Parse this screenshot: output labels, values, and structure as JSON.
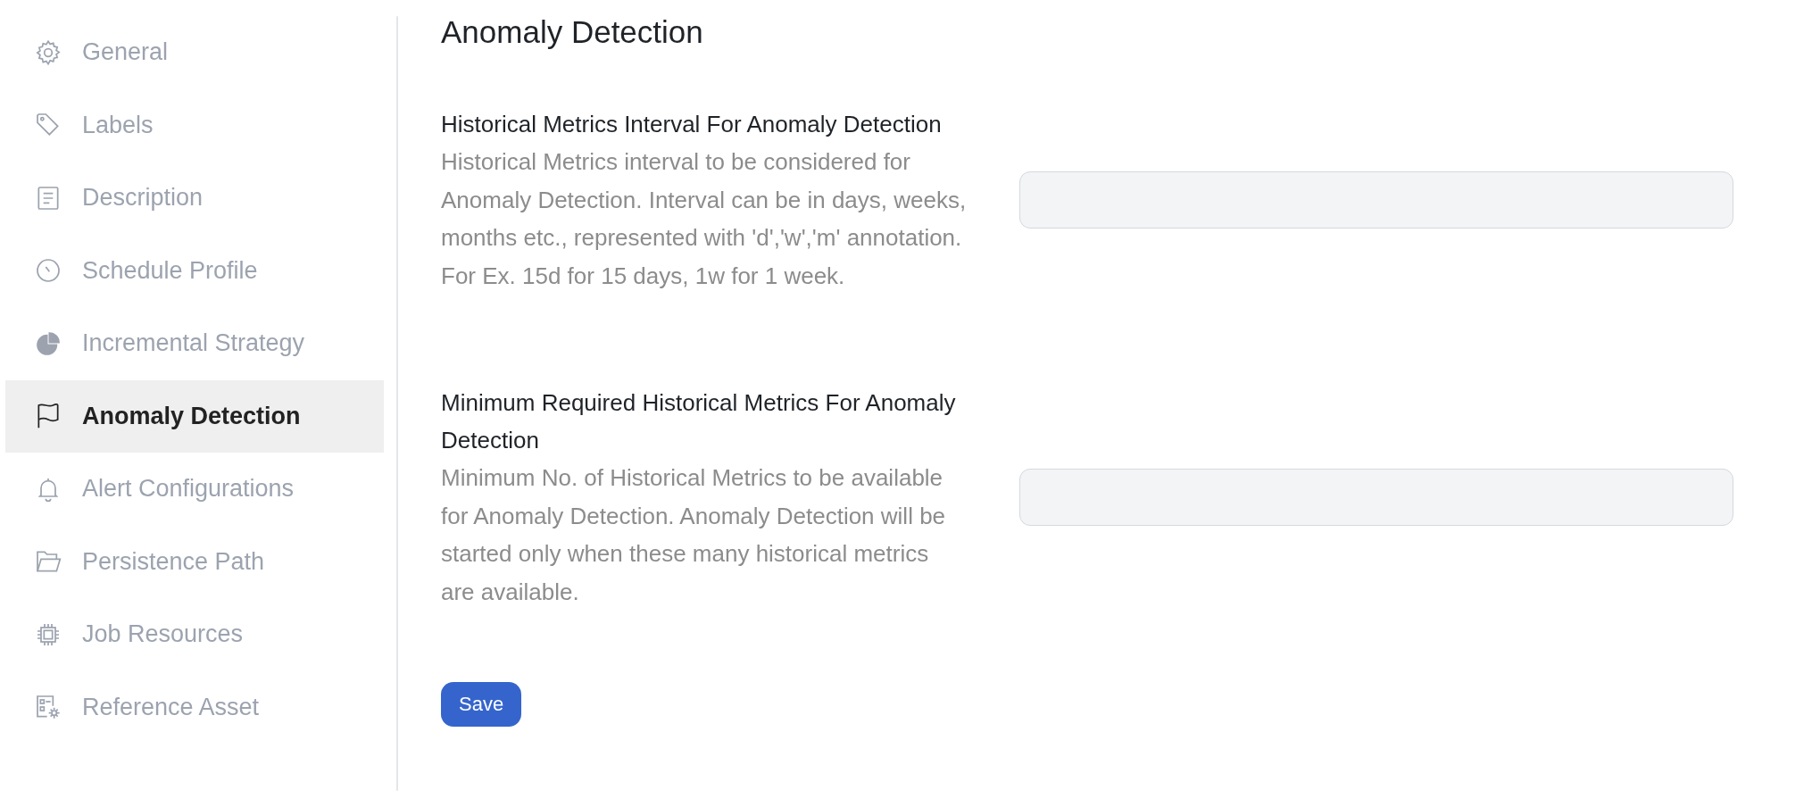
{
  "sidebar": {
    "items": [
      {
        "label": "General",
        "selected": false
      },
      {
        "label": "Labels",
        "selected": false
      },
      {
        "label": "Description",
        "selected": false
      },
      {
        "label": "Schedule Profile",
        "selected": false
      },
      {
        "label": "Incremental Strategy",
        "selected": false
      },
      {
        "label": "Anomaly Detection",
        "selected": true
      },
      {
        "label": "Alert Configurations",
        "selected": false
      },
      {
        "label": "Persistence Path",
        "selected": false
      },
      {
        "label": "Job Resources",
        "selected": false
      },
      {
        "label": "Reference Asset",
        "selected": false
      }
    ]
  },
  "main": {
    "title": "Anomaly Detection",
    "settings": [
      {
        "label": "Historical Metrics Interval For Anomaly Detection",
        "description": "Historical Metrics interval to be considered for Anomaly Detection. Interval can be in days, weeks, months etc., represented with 'd','w','m' annotation. For Ex. 15d for 15 days, 1w for 1 week."
      },
      {
        "label": "Minimum Required Historical Metrics For Anomaly Detection",
        "description": "Minimum No. of Historical Metrics to be available for Anomaly Detection. Anomaly Detection will be started only when these many historical metrics are available."
      }
    ],
    "save_button": "Save"
  }
}
